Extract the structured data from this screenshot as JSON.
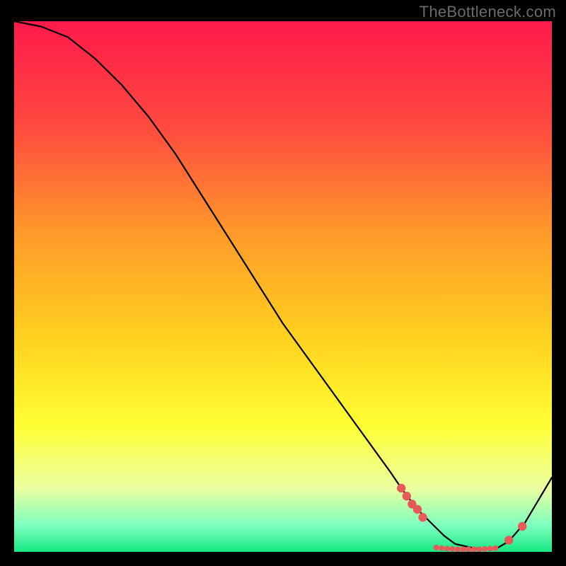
{
  "watermark": "TheBottleneck.com",
  "chart_data": {
    "type": "line",
    "title": "",
    "xlabel": "",
    "ylabel": "",
    "xlim": [
      0,
      100
    ],
    "ylim": [
      0,
      100
    ],
    "gradient_stops": [
      {
        "pos": 0.0,
        "color": "#ff1a4b"
      },
      {
        "pos": 0.2,
        "color": "#ff4a3f"
      },
      {
        "pos": 0.4,
        "color": "#ff9a2a"
      },
      {
        "pos": 0.6,
        "color": "#ffd21f"
      },
      {
        "pos": 0.76,
        "color": "#fffe33"
      },
      {
        "pos": 0.88,
        "color": "#ecffa0"
      },
      {
        "pos": 0.95,
        "color": "#7dffbe"
      },
      {
        "pos": 1.0,
        "color": "#17e884"
      }
    ],
    "series": [
      {
        "name": "bottleneck-curve",
        "color": "#000000",
        "width": 2.2,
        "x": [
          0,
          5,
          10,
          15,
          20,
          25,
          30,
          35,
          40,
          45,
          50,
          55,
          60,
          65,
          70,
          72,
          75,
          78,
          80,
          82,
          85,
          87,
          90,
          92,
          95,
          100
        ],
        "y": [
          100,
          99,
          97,
          93,
          88,
          82,
          75,
          67,
          59,
          51,
          43,
          36,
          29,
          22,
          15,
          12,
          8,
          5,
          3,
          1.5,
          0.8,
          0.5,
          0.8,
          2,
          5.5,
          14
        ]
      }
    ],
    "markers": {
      "name": "bottleneck-markers",
      "color": "#e85a5a",
      "radius_big": 6.2,
      "radius_small": 4.0,
      "points": [
        {
          "x": 72,
          "y": 12,
          "r": "big"
        },
        {
          "x": 73,
          "y": 10.5,
          "r": "big"
        },
        {
          "x": 74,
          "y": 9,
          "r": "big"
        },
        {
          "x": 75,
          "y": 8,
          "r": "big"
        },
        {
          "x": 76,
          "y": 6.5,
          "r": "big"
        },
        {
          "x": 78.5,
          "y": 0.8,
          "r": "small"
        },
        {
          "x": 79.5,
          "y": 0.7,
          "r": "small"
        },
        {
          "x": 80.5,
          "y": 0.6,
          "r": "small"
        },
        {
          "x": 81.5,
          "y": 0.55,
          "r": "small"
        },
        {
          "x": 82.5,
          "y": 0.5,
          "r": "small"
        },
        {
          "x": 83.5,
          "y": 0.5,
          "r": "small"
        },
        {
          "x": 84.5,
          "y": 0.5,
          "r": "small"
        },
        {
          "x": 85.5,
          "y": 0.5,
          "r": "small"
        },
        {
          "x": 86.5,
          "y": 0.5,
          "r": "small"
        },
        {
          "x": 87.5,
          "y": 0.55,
          "r": "small"
        },
        {
          "x": 88.5,
          "y": 0.6,
          "r": "small"
        },
        {
          "x": 89.5,
          "y": 0.7,
          "r": "small"
        },
        {
          "x": 92,
          "y": 2.2,
          "r": "big"
        },
        {
          "x": 94.5,
          "y": 4.8,
          "r": "big"
        }
      ]
    }
  }
}
